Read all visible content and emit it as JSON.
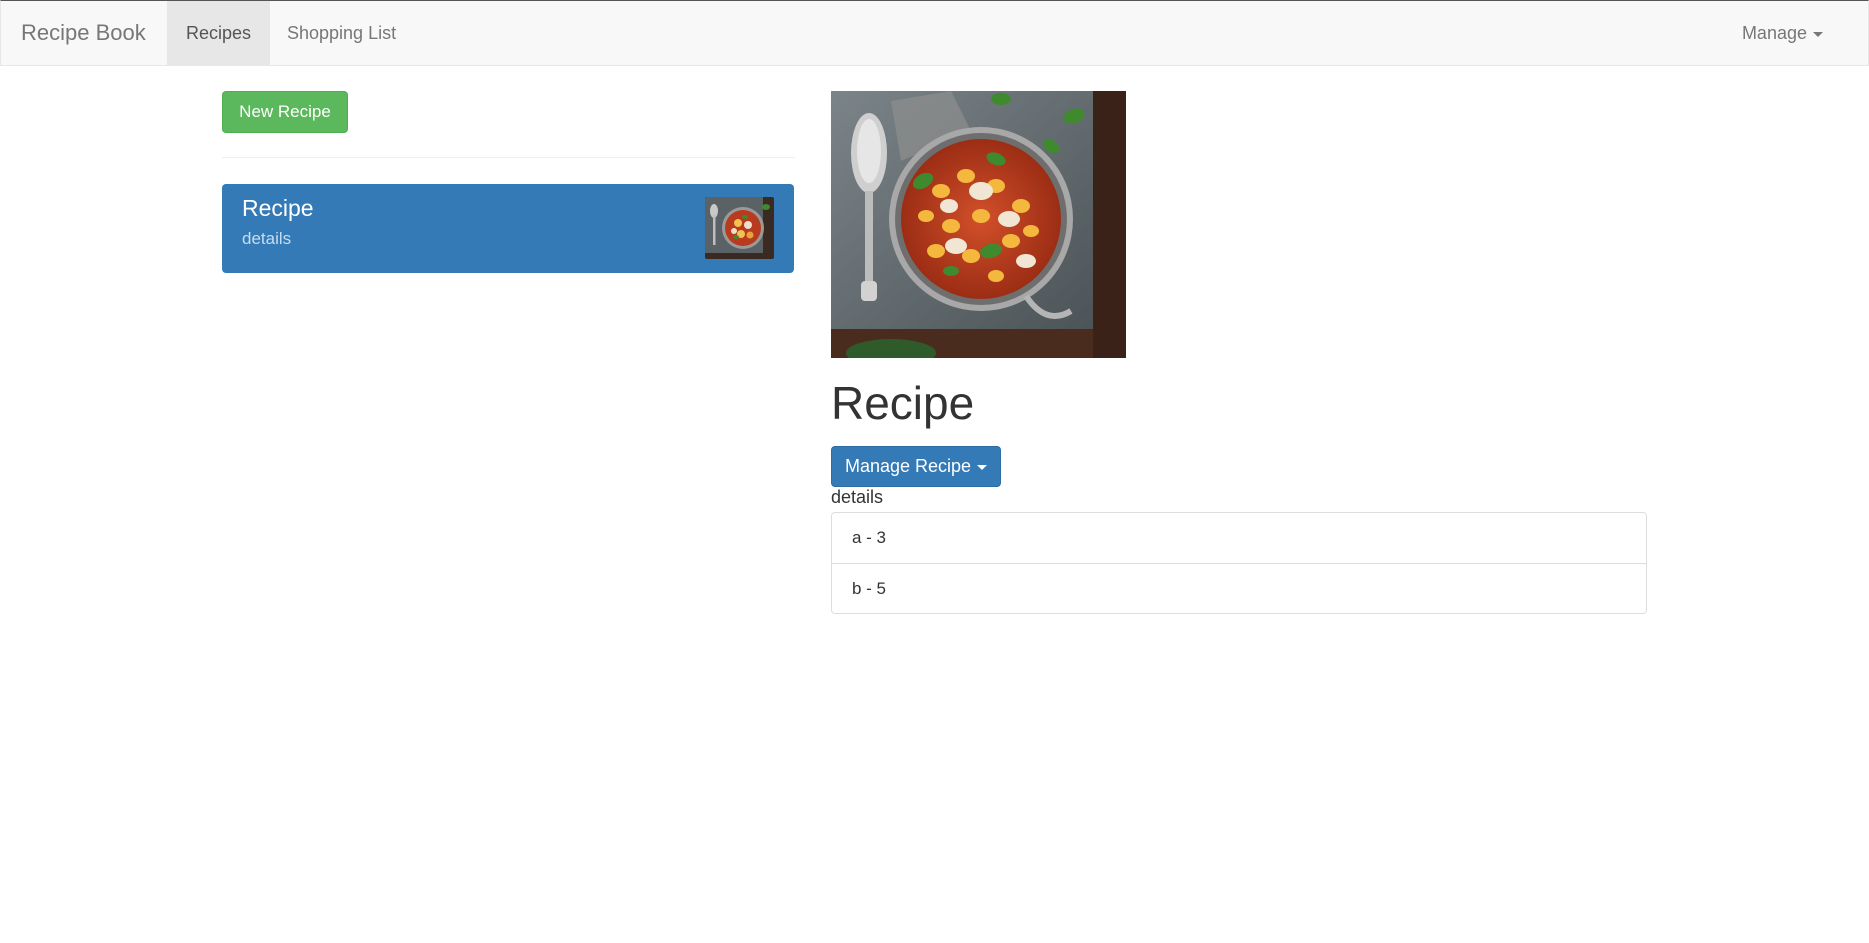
{
  "navbar": {
    "brand": "Recipe Book",
    "links": [
      {
        "label": "Recipes",
        "active": true
      },
      {
        "label": "Shopping List",
        "active": false
      }
    ],
    "manage_label": "Manage"
  },
  "sidebar": {
    "new_recipe_label": "New Recipe",
    "recipes": [
      {
        "name": "Recipe",
        "description": "details",
        "selected": true
      }
    ]
  },
  "detail": {
    "title": "Recipe",
    "manage_label": "Manage Recipe",
    "description": "details",
    "ingredients": [
      {
        "text": "a - 3"
      },
      {
        "text": "b - 5"
      }
    ]
  },
  "colors": {
    "primary": "#337ab7",
    "success": "#5cb85c",
    "navbar_bg": "#f8f8f8"
  },
  "icons": [
    "caret-down-icon",
    "dish-photo"
  ]
}
